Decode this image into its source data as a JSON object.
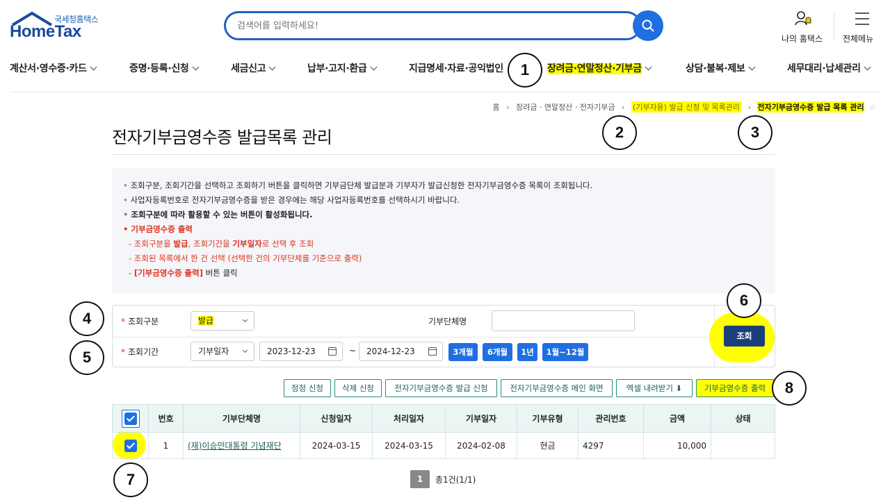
{
  "header": {
    "logo_kr": "국세청홈택스",
    "logo_en": "HomeTax",
    "search_placeholder": "검색어를 입력하세요!",
    "my_hometax": "나의 홈택스",
    "all_menu": "전체메뉴"
  },
  "gnb": [
    {
      "label": "계산서·영수증·카드"
    },
    {
      "label": "증명·등록·신청"
    },
    {
      "label": "세금신고"
    },
    {
      "label": "납부·고지·환급"
    },
    {
      "label": "지급명세·자료·공익법인"
    },
    {
      "label": "장려금·연말정산·기부금"
    },
    {
      "label": "상담·불복·제보"
    },
    {
      "label": "세무대리·납세관리"
    }
  ],
  "breadcrumb": {
    "home": "홈",
    "l1": "장려금 · 연말정산 · 전자기부금",
    "l2": "(기부자용) 발급 신청 및 목록관리",
    "current": "전자기부금영수증 발급 목록 관리"
  },
  "page_title": "전자기부금영수증 발급목록 관리",
  "info": {
    "line1": "조회구분, 조회기간을 선택하고 조회하기 버튼을 클릭하면 기부금단체 발급분과 기부자가 발급신청한 전자기부금영수증 목록이 조회됩니다.",
    "line2": "사업자등록번호로 전자기부금영수증을 받은 경우에는 해당 사업자등록번호를 선택하시기 바랍니다.",
    "line3": "조회구분에 따라 활용할 수 있는 버튼이 활성화됩니다.",
    "line4": "기부금영수증 출력",
    "sub1_a": "- 조회구분을 ",
    "sub1_b": "발급",
    "sub1_c": ", 조회기간을 ",
    "sub1_d": "기부일자",
    "sub1_e": "로 선택 후 조회",
    "sub2": "- 조회된 목록에서 한 건 선택 (선택한 건의 기부단체를 기준으로 출력)",
    "sub3_a": "- ",
    "sub3_b": "[기부금영수증 출력]",
    "sub3_c": " 버튼 클릭"
  },
  "form": {
    "type_label": "조회구분",
    "type_value": "발급",
    "org_label": "기부단체명",
    "org_value": "",
    "period_label": "조회기간",
    "period_type": "기부일자",
    "date_from": "2023-12-23",
    "tilde": "~",
    "date_to": "2024-12-23",
    "p3": "3개월",
    "p6": "6개월",
    "p12": "1년",
    "pmonth": "1월~12월",
    "search_btn": "조회"
  },
  "actions": {
    "correct": "정정 신청",
    "delete": "삭제 신청",
    "issue": "전자기부금영수증 발급 신청",
    "main": "전자기부금영수증 메인 화면",
    "excel": "엑셀 내려받기",
    "print": "기부금영수증 출력"
  },
  "table": {
    "headers": [
      "번호",
      "기부단체명",
      "신청일자",
      "처리일자",
      "기부일자",
      "기부유형",
      "관리번호",
      "금액",
      "상태"
    ],
    "rows": [
      [
        "1",
        "(재)이승만대통령 기념재단",
        "2024-03-15",
        "2024-03-15",
        "2024-02-08",
        "현금",
        "4297",
        "10,000",
        ""
      ]
    ]
  },
  "pager": {
    "page": "1",
    "summary": "총1건(1/1)"
  },
  "annotations": [
    "1",
    "2",
    "3",
    "4",
    "5",
    "6",
    "7",
    "8"
  ],
  "colors": {
    "primary": "#1f6fe0",
    "highlight": "#ffff00",
    "teal": "#1c5f5a",
    "dark_button": "#1b3f7a"
  }
}
